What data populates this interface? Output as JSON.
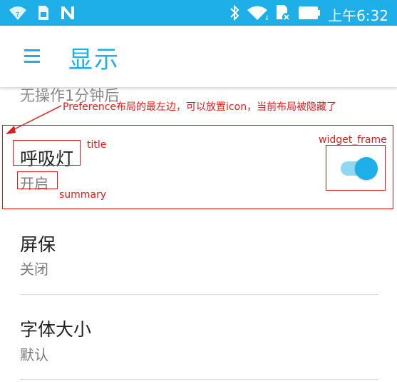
{
  "status_bar": {
    "time": "上午6:32",
    "icons": [
      "wifi-question-icon",
      "sim-card-icon",
      "n-logo-icon",
      "bluetooth-icon",
      "wifi-icon",
      "sd-card-icon",
      "battery-icon"
    ],
    "background_color": "#1eaee8"
  },
  "app_bar": {
    "title": "显示",
    "menu_icon": "hamburger-menu-icon",
    "accent_color": "#1eaee8"
  },
  "clipped_item": {
    "summary": "无操作1分钟后"
  },
  "preferences": [
    {
      "title": "呼吸灯",
      "summary": "开启",
      "widget": "switch",
      "checked": true
    },
    {
      "title": "屏保",
      "summary": "关闭"
    },
    {
      "title": "字体大小",
      "summary": "默认"
    }
  ],
  "annotations": {
    "icon_note": "Preference布局的最左边，可以放置icon，当前布局被隐藏了",
    "title_label": "title",
    "summary_label": "summary",
    "widget_label": "widget_frame",
    "color": "#e21a1a"
  }
}
